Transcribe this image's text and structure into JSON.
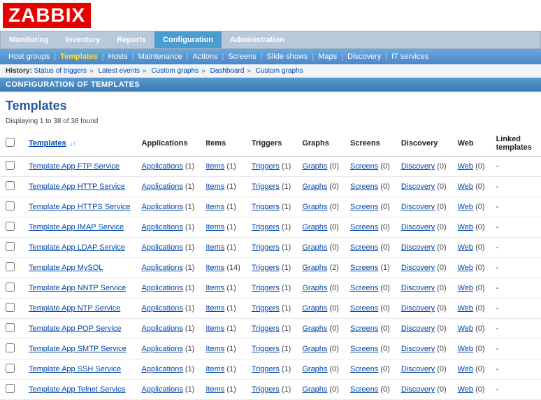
{
  "logo": "ZABBIX",
  "main_tabs": [
    "Monitoring",
    "Inventory",
    "Reports",
    "Configuration",
    "Administration"
  ],
  "main_tab_active": 3,
  "sub_tabs": [
    "Host groups",
    "Templates",
    "Hosts",
    "Maintenance",
    "Actions",
    "Screens",
    "Slide shows",
    "Maps",
    "Discovery",
    "IT services"
  ],
  "sub_tab_active": 1,
  "history_label": "History:",
  "history_items": [
    "Status of triggers",
    "Latest events",
    "Custom graphs",
    "Dashboard",
    "Custom graphs"
  ],
  "conf_bar": "CONFIGURATION OF TEMPLATES",
  "page_title": "Templates",
  "display_count": "Displaying 1 to 38 of 38 found",
  "headers": {
    "templates": "Templates",
    "applications": "Applications",
    "items": "Items",
    "triggers": "Triggers",
    "graphs": "Graphs",
    "screens": "Screens",
    "discovery": "Discovery",
    "web": "Web",
    "linked": "Linked templates"
  },
  "link_labels": {
    "applications": "Applications",
    "items": "Items",
    "triggers": "Triggers",
    "graphs": "Graphs",
    "screens": "Screens",
    "discovery": "Discovery",
    "web": "Web"
  },
  "rows": [
    {
      "name": "Template App FTP Service",
      "apps": 1,
      "items": 1,
      "triggers": 1,
      "graphs": 0,
      "screens": 0,
      "discovery": 0,
      "web": 0,
      "linked": "-"
    },
    {
      "name": "Template App HTTP Service",
      "apps": 1,
      "items": 1,
      "triggers": 1,
      "graphs": 0,
      "screens": 0,
      "discovery": 0,
      "web": 0,
      "linked": "-"
    },
    {
      "name": "Template App HTTPS Service",
      "apps": 1,
      "items": 1,
      "triggers": 1,
      "graphs": 0,
      "screens": 0,
      "discovery": 0,
      "web": 0,
      "linked": "-"
    },
    {
      "name": "Template App IMAP Service",
      "apps": 1,
      "items": 1,
      "triggers": 1,
      "graphs": 0,
      "screens": 0,
      "discovery": 0,
      "web": 0,
      "linked": "-"
    },
    {
      "name": "Template App LDAP Service",
      "apps": 1,
      "items": 1,
      "triggers": 1,
      "graphs": 0,
      "screens": 0,
      "discovery": 0,
      "web": 0,
      "linked": "-"
    },
    {
      "name": "Template App MySQL",
      "apps": 1,
      "items": 14,
      "triggers": 1,
      "graphs": 2,
      "screens": 1,
      "discovery": 0,
      "web": 0,
      "linked": "-"
    },
    {
      "name": "Template App NNTP Service",
      "apps": 1,
      "items": 1,
      "triggers": 1,
      "graphs": 0,
      "screens": 0,
      "discovery": 0,
      "web": 0,
      "linked": "-"
    },
    {
      "name": "Template App NTP Service",
      "apps": 1,
      "items": 1,
      "triggers": 1,
      "graphs": 0,
      "screens": 0,
      "discovery": 0,
      "web": 0,
      "linked": "-"
    },
    {
      "name": "Template App POP Service",
      "apps": 1,
      "items": 1,
      "triggers": 1,
      "graphs": 0,
      "screens": 0,
      "discovery": 0,
      "web": 0,
      "linked": "-"
    },
    {
      "name": "Template App SMTP Service",
      "apps": 1,
      "items": 1,
      "triggers": 1,
      "graphs": 0,
      "screens": 0,
      "discovery": 0,
      "web": 0,
      "linked": "-"
    },
    {
      "name": "Template App SSH Service",
      "apps": 1,
      "items": 1,
      "triggers": 1,
      "graphs": 0,
      "screens": 0,
      "discovery": 0,
      "web": 0,
      "linked": "-"
    },
    {
      "name": "Template App Telnet Service",
      "apps": 1,
      "items": 1,
      "triggers": 1,
      "graphs": 0,
      "screens": 0,
      "discovery": 0,
      "web": 0,
      "linked": "-"
    }
  ]
}
